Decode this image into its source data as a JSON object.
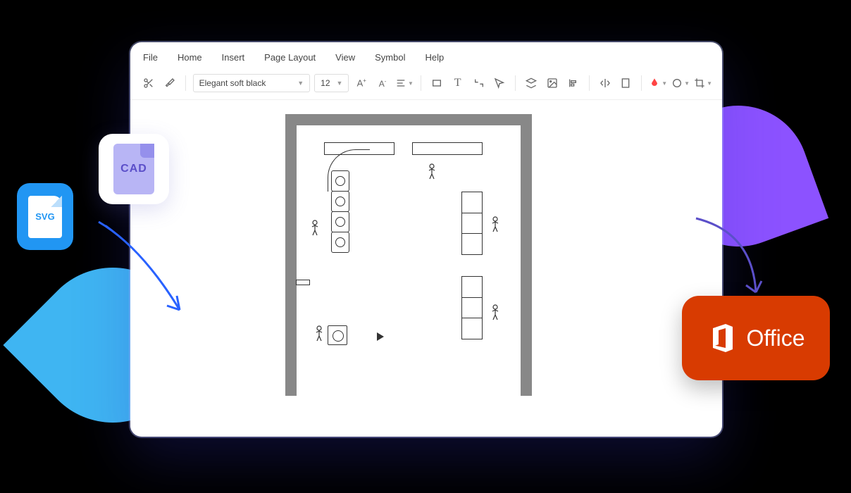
{
  "menubar": {
    "file": "File",
    "home": "Home",
    "insert": "Insert",
    "page_layout": "Page Layout",
    "view": "View",
    "symbol": "Symbol",
    "help": "Help"
  },
  "toolbar": {
    "font_name": "Elegant soft black",
    "font_size": "12"
  },
  "badges": {
    "svg": "SVG",
    "cad": "CAD",
    "office": "Office"
  }
}
